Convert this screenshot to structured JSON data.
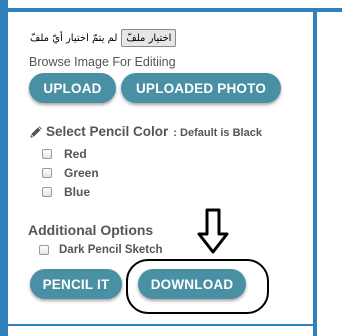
{
  "colors": {
    "frame": "#2f7fbd",
    "button": "#4a90a4",
    "button_text": "#ffffff",
    "label_text": "#555555",
    "annotation": "#000000"
  },
  "file_input": {
    "button_label": "اختيار ملفّ",
    "status": "لم يتمّ اختيار أيّ ملفّ"
  },
  "browse": {
    "label": "Browse Image For Editiing",
    "upload_label": "UPLOAD",
    "uploaded_photo_label": "UPLOADED PHOTO"
  },
  "pencil_color": {
    "icon": "pencil-icon",
    "title": "Select Pencil Color",
    "default_note": ": Default is Black",
    "options": [
      {
        "label": "Red",
        "checked": false
      },
      {
        "label": "Green",
        "checked": false
      },
      {
        "label": "Blue",
        "checked": false
      }
    ]
  },
  "additional": {
    "title": "Additional Options",
    "options": [
      {
        "label": "Dark Pencil Sketch",
        "checked": false
      }
    ]
  },
  "actions": {
    "pencil_it_label": "PENCIL IT",
    "download_label": "DOWNLOAD"
  }
}
